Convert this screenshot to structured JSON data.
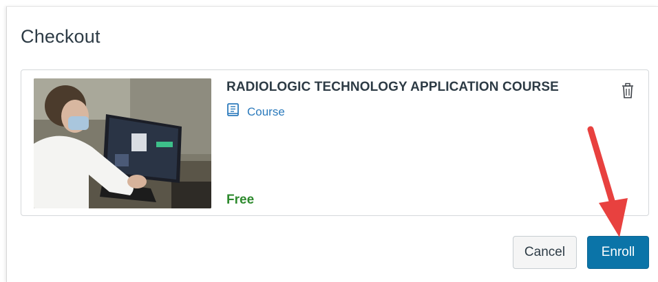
{
  "modal": {
    "title": "Checkout"
  },
  "cart_item": {
    "name": "RADIOLOGIC TECHNOLOGY APPLICATION COURSE",
    "type_label": "Course",
    "type_icon": "book-icon",
    "price": "Free",
    "remove_icon": "trash-icon"
  },
  "actions": {
    "cancel_label": "Cancel",
    "enroll_label": "Enroll"
  },
  "colors": {
    "accent": "#0b74a8",
    "link": "#2b7abc",
    "price": "#2e8a2e",
    "annotation_arrow": "#e8413f"
  }
}
